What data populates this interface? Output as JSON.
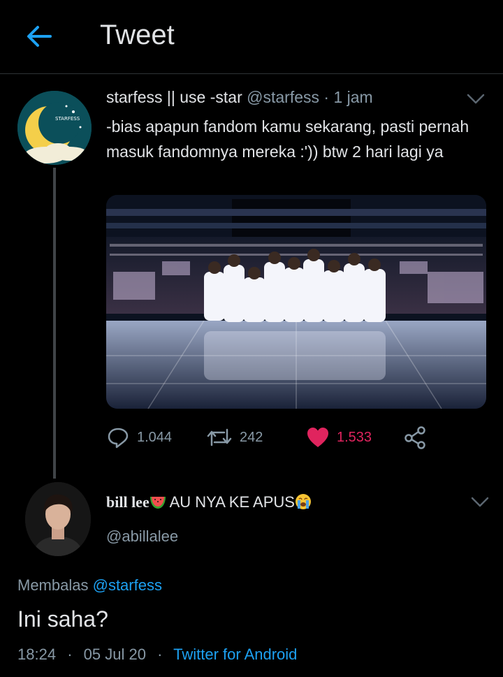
{
  "header": {
    "title": "Tweet"
  },
  "tweet": {
    "author_name": "starfess || use -star",
    "author_handle": "@starfess",
    "separator": "·",
    "time": "1 jam",
    "text": "-bias apapun fandom kamu sekarang, pasti pernah masuk fandomnya mereka :')) btw 2 hari lagi ya",
    "avatar_logo_text": "STARFESS",
    "replies": "1.044",
    "retweets": "242",
    "likes": "1.533",
    "liked": true
  },
  "reply": {
    "author_name": "bill lee",
    "author_name_text": "AU NYA KE APUS",
    "author_handle": "@abillalee",
    "replying_prefix": "Membalas",
    "replying_to": "@starfess",
    "text": "Ini saha?",
    "time": "18:24",
    "date": "05 Jul 20",
    "source": "Twitter for Android",
    "separator": "·"
  },
  "colors": {
    "accent": "#1da1f2",
    "like": "#e0245e",
    "muted": "#8899a6",
    "background": "#000000"
  },
  "icons": [
    "back-arrow-icon",
    "chevron-down-icon",
    "reply-icon",
    "retweet-icon",
    "heart-icon",
    "share-icon",
    "watermelon-emoji",
    "crying-emoji"
  ]
}
